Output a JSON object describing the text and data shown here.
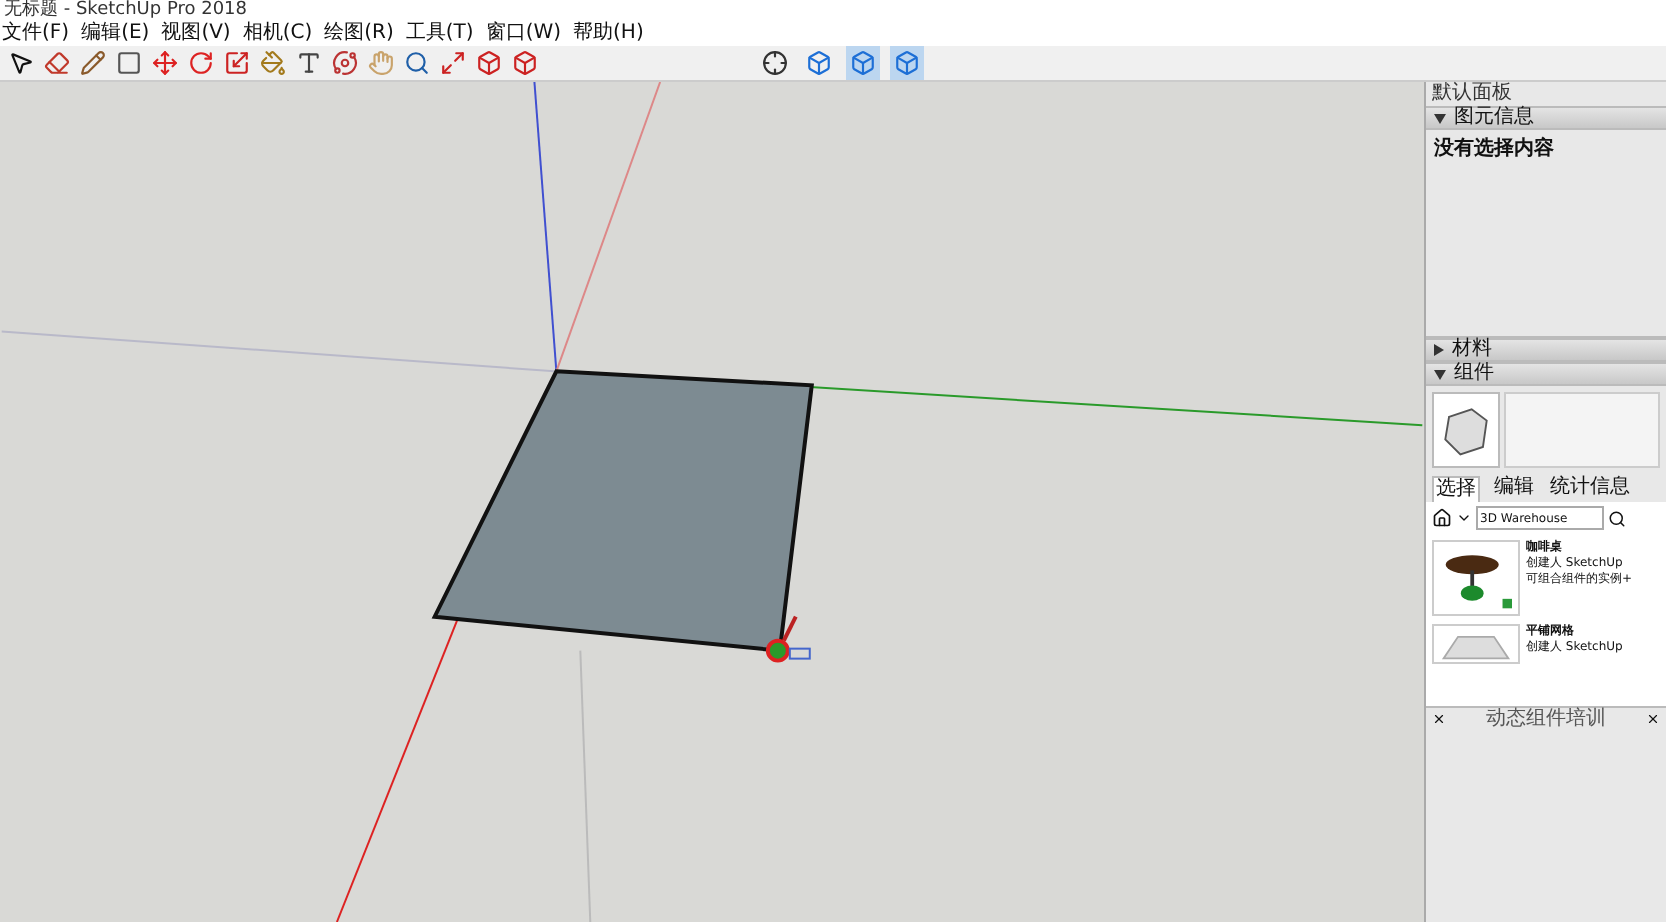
{
  "window": {
    "title": "无标题 - SketchUp Pro 2018"
  },
  "menu": [
    "文件(F)",
    "编辑(E)",
    "视图(V)",
    "相机(C)",
    "绘图(R)",
    "工具(T)",
    "窗口(W)",
    "帮助(H)"
  ],
  "tray": {
    "title": "默认面板",
    "sections": [
      {
        "title": "图元信息",
        "expanded": true
      },
      {
        "title": "材料",
        "expanded": false
      },
      {
        "title": "组件",
        "expanded": true
      }
    ],
    "entity_info": "没有选择内容",
    "tabs": [
      {
        "label": "选择",
        "selected": true
      },
      {
        "label": "编辑",
        "selected": false
      },
      {
        "label": "统计信息",
        "selected": false
      }
    ],
    "search": {
      "value": "3D Warehouse"
    },
    "items": [
      {
        "kind": "table",
        "name": "咖啡桌",
        "creator": "创建人 SketchUp",
        "description": "可组合组件的实例+"
      },
      {
        "kind": "grid",
        "name": "平铺网格",
        "creator": "创建人 SketchUp"
      }
    ],
    "footer": "动态组件培训"
  }
}
